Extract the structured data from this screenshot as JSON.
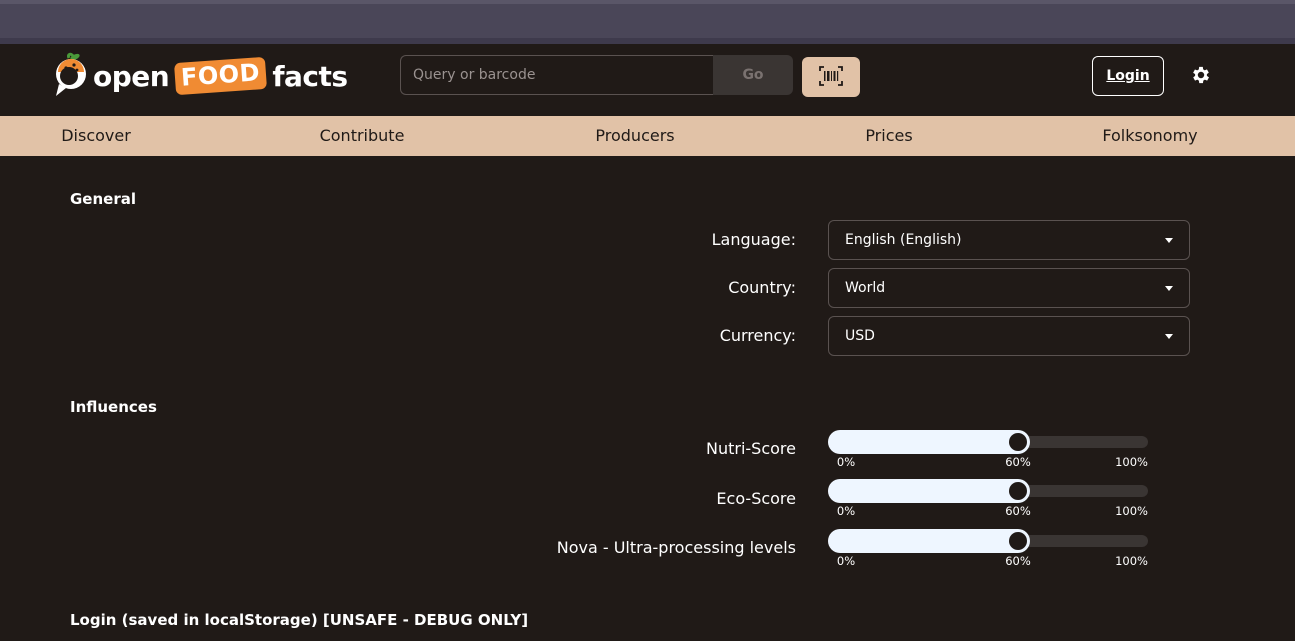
{
  "header": {
    "logo": {
      "open": "open",
      "food": "FOOD",
      "facts": "facts"
    },
    "search": {
      "placeholder": "Query or barcode",
      "go_label": "Go"
    },
    "login_label": "Login",
    "icons": {
      "barcode": "barcode-scan-icon",
      "settings": "gear-icon"
    }
  },
  "nav": {
    "items": [
      {
        "label": "Discover"
      },
      {
        "label": "Contribute"
      },
      {
        "label": "Producers"
      },
      {
        "label": "Prices"
      },
      {
        "label": "Folksonomy"
      }
    ]
  },
  "general": {
    "title": "General",
    "fields": [
      {
        "label": "Language:",
        "value": "English (English)"
      },
      {
        "label": "Country:",
        "value": "World"
      },
      {
        "label": "Currency:",
        "value": "USD"
      }
    ]
  },
  "influences": {
    "title": "Influences",
    "sliders": [
      {
        "label": "Nutri-Score",
        "value_percent": 60,
        "value_label": "60%",
        "min_label": "0%",
        "max_label": "100%"
      },
      {
        "label": "Eco-Score",
        "value_percent": 60,
        "value_label": "60%",
        "min_label": "0%",
        "max_label": "100%"
      },
      {
        "label": "Nova - Ultra-processing levels",
        "value_percent": 60,
        "value_label": "60%",
        "min_label": "0%",
        "max_label": "100%"
      }
    ]
  },
  "login_section": {
    "title": "Login (saved in localStorage) [UNSAFE - DEBUG ONLY]"
  },
  "colors": {
    "background": "#201a17",
    "nav_background": "#e1c2a7",
    "accent_orange": "#f08b33",
    "slider_fill": "#eef6ff",
    "browser_chrome": "#4a4658"
  }
}
